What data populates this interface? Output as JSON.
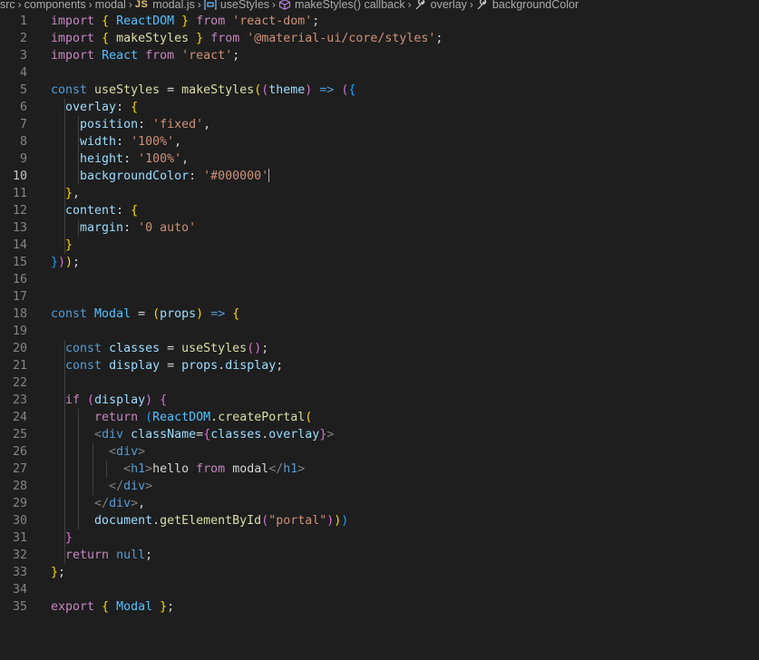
{
  "breadcrumb": {
    "items": [
      {
        "label": "src",
        "icon": ""
      },
      {
        "label": "components",
        "icon": ""
      },
      {
        "label": "modal",
        "icon": ""
      },
      {
        "label": "modal.js",
        "icon": "js-file-icon",
        "icon_text": "JS"
      },
      {
        "label": "useStyles",
        "icon": "variable-icon"
      },
      {
        "label": "makeStyles() callback",
        "icon": "method-icon"
      },
      {
        "label": "overlay",
        "icon": "property-icon"
      },
      {
        "label": "backgroundColor",
        "icon": "property-icon"
      }
    ]
  },
  "editor": {
    "active_line": 10,
    "lines": [
      {
        "n": "1",
        "text": "import { ReactDOM } from 'react-dom';"
      },
      {
        "n": "2",
        "text": "import { makeStyles } from '@material-ui/core/styles';"
      },
      {
        "n": "3",
        "text": "import React from 'react';"
      },
      {
        "n": "4",
        "text": ""
      },
      {
        "n": "5",
        "text": "const useStyles = makeStyles((theme) => ({"
      },
      {
        "n": "6",
        "text": "  overlay: {"
      },
      {
        "n": "7",
        "text": "    position: 'fixed',"
      },
      {
        "n": "8",
        "text": "    width: '100%',"
      },
      {
        "n": "9",
        "text": "    height: '100%',"
      },
      {
        "n": "10",
        "text": "    backgroundColor: '#000000'"
      },
      {
        "n": "11",
        "text": "  },"
      },
      {
        "n": "12",
        "text": "  content: {"
      },
      {
        "n": "13",
        "text": "    margin: '0 auto'"
      },
      {
        "n": "14",
        "text": "  }"
      },
      {
        "n": "15",
        "text": "}));"
      },
      {
        "n": "16",
        "text": ""
      },
      {
        "n": "17",
        "text": ""
      },
      {
        "n": "18",
        "text": "const Modal = (props) => {"
      },
      {
        "n": "19",
        "text": ""
      },
      {
        "n": "20",
        "text": "  const classes = useStyles();"
      },
      {
        "n": "21",
        "text": "  const display = props.display;"
      },
      {
        "n": "22",
        "text": ""
      },
      {
        "n": "23",
        "text": "  if (display) {"
      },
      {
        "n": "24",
        "text": "      return (ReactDOM.createPortal("
      },
      {
        "n": "25",
        "text": "      <div className={classes.overlay}>"
      },
      {
        "n": "26",
        "text": "        <div>"
      },
      {
        "n": "27",
        "text": "          <h1>hello from modal</h1>"
      },
      {
        "n": "28",
        "text": "        </div>"
      },
      {
        "n": "29",
        "text": "      </div>,"
      },
      {
        "n": "30",
        "text": "      document.getElementById(\"portal\")))"
      },
      {
        "n": "31",
        "text": "  }"
      },
      {
        "n": "32",
        "text": "  return null;"
      },
      {
        "n": "33",
        "text": "};"
      },
      {
        "n": "34",
        "text": ""
      },
      {
        "n": "35",
        "text": "export { Modal };"
      }
    ]
  },
  "colors": {
    "background": "#1e1e1e",
    "keyword": "#c586c0",
    "storage": "#569cd6",
    "string": "#ce9178",
    "function": "#dcdcaa",
    "variable": "#9cdcfe",
    "line_number": "#858585"
  }
}
